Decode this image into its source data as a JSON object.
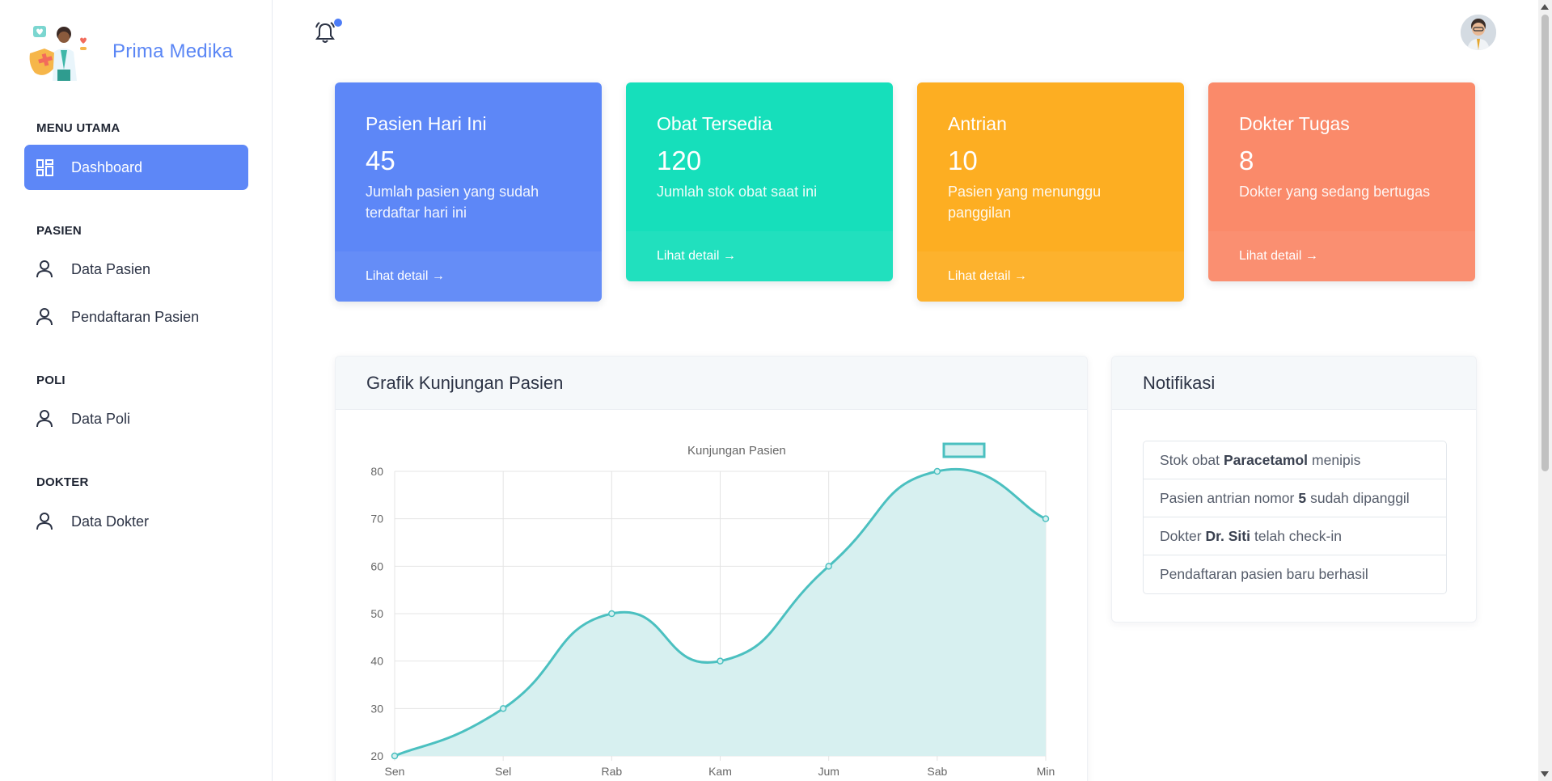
{
  "brand": {
    "name": "Prima Medika",
    "logo_icon": "doctor-illustration-icon"
  },
  "sidebar": {
    "sections": [
      {
        "title": "MENU UTAMA",
        "items": [
          {
            "label": "Dashboard",
            "icon": "dashboard-icon",
            "active": true
          }
        ]
      },
      {
        "title": "PASIEN",
        "items": [
          {
            "label": "Data Pasien",
            "icon": "user-icon"
          },
          {
            "label": "Pendaftaran Pasien",
            "icon": "user-icon"
          }
        ]
      },
      {
        "title": "POLI",
        "items": [
          {
            "label": "Data Poli",
            "icon": "user-icon"
          }
        ]
      },
      {
        "title": "DOKTER",
        "items": [
          {
            "label": "Data Dokter",
            "icon": "user-icon"
          }
        ]
      }
    ]
  },
  "topbar": {
    "notification_icon": "bell-icon",
    "has_unread": true,
    "avatar_icon": "user-avatar"
  },
  "cards": [
    {
      "title": "Pasien Hari Ini",
      "value": "45",
      "desc": "Jumlah pasien yang sudah terdaftar hari ini",
      "link": "Lihat detail →",
      "color": "#5d87f7"
    },
    {
      "title": "Obat Tersedia",
      "value": "120",
      "desc": "Jumlah stok obat saat ini",
      "link": "Lihat detail →",
      "color": "#16dfbb"
    },
    {
      "title": "Antrian",
      "value": "10",
      "desc": "Pasien yang menunggu panggilan",
      "link": "Lihat detail →",
      "color": "#fdae22"
    },
    {
      "title": "Dokter Tugas",
      "value": "8",
      "desc": "Dokter yang sedang bertugas",
      "link": "Lihat detail →",
      "color": "#fa8a6a"
    }
  ],
  "chart_panel": {
    "title": "Grafik Kunjungan Pasien"
  },
  "chart_data": {
    "type": "line",
    "categories": [
      "Sen",
      "Sel",
      "Rab",
      "Kam",
      "Jum",
      "Sab",
      "Min"
    ],
    "series": [
      {
        "name": "Kunjungan Pasien",
        "values": [
          20,
          30,
          50,
          40,
          60,
          80,
          70
        ]
      }
    ],
    "ylim": [
      20,
      80
    ],
    "yticks": [
      20,
      30,
      40,
      50,
      60,
      70,
      80
    ],
    "fill": true,
    "line_color": "#4bc0c0",
    "fill_color": "#d7f0f0",
    "legend_position": "top",
    "grid": true
  },
  "notifications": {
    "title": "Notifikasi",
    "items": [
      {
        "before": "Stok obat",
        "bold": "Paracetamol",
        "after": "menipis"
      },
      {
        "before": "Pasien antrian nomor",
        "bold": "5",
        "after": "sudah dipanggil"
      },
      {
        "before": "Dokter",
        "bold": "Dr. Siti",
        "after": "telah check-in"
      },
      {
        "before": "Pendaftaran pasien baru berhasil",
        "bold": "",
        "after": ""
      }
    ]
  }
}
